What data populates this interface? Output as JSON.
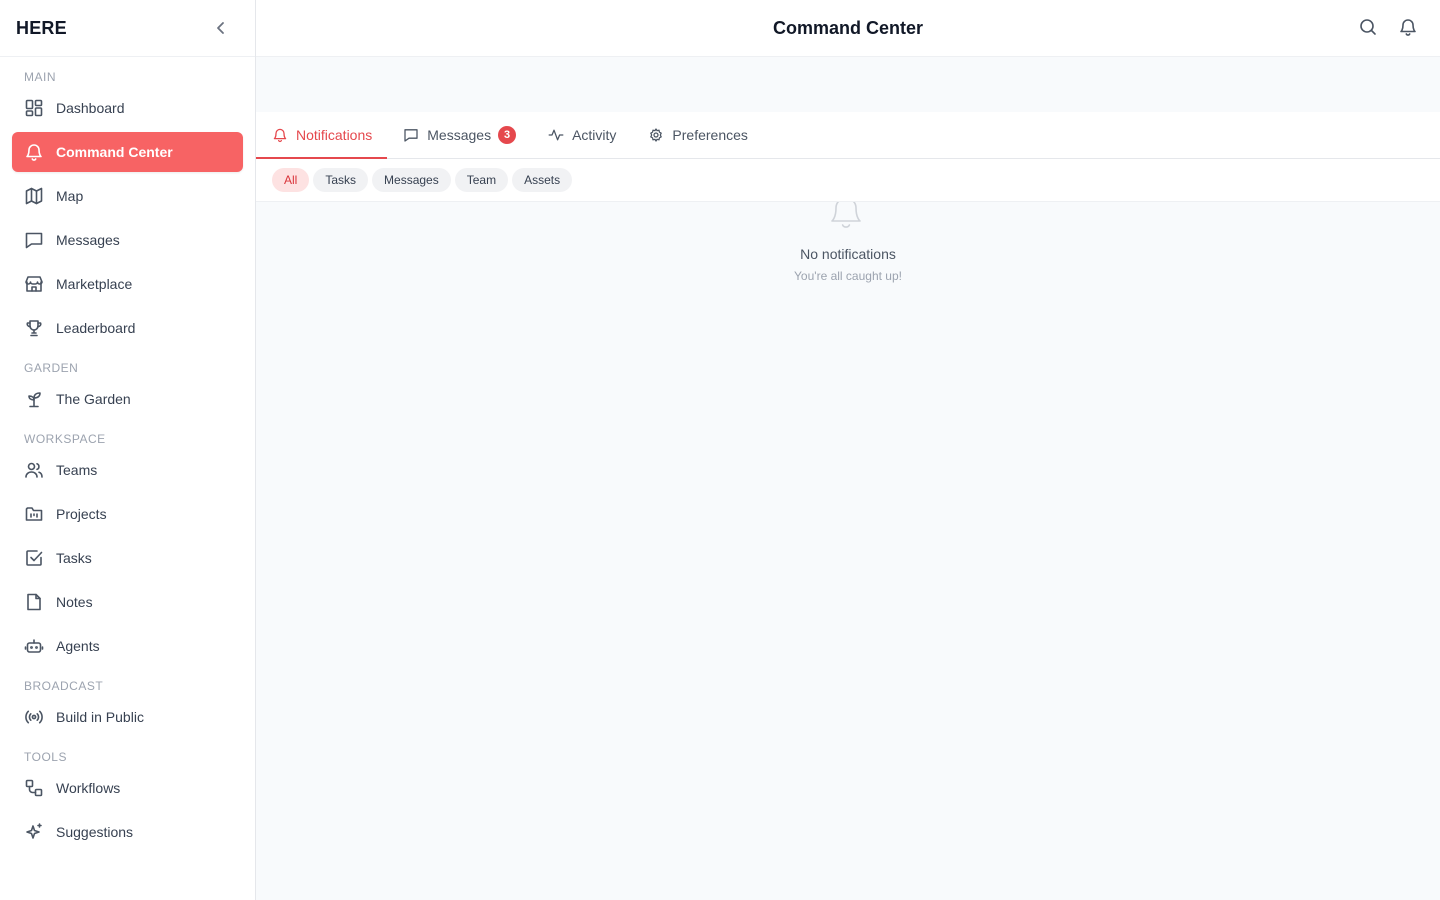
{
  "app": {
    "brand": "HERE",
    "page_title": "Command Center"
  },
  "sidebar": {
    "sections": [
      {
        "label": "MAIN",
        "items": [
          {
            "label": "Dashboard",
            "icon": "dashboard-icon"
          },
          {
            "label": "Command Center",
            "icon": "bell-icon",
            "active": true
          },
          {
            "label": "Map",
            "icon": "map-icon"
          },
          {
            "label": "Messages",
            "icon": "message-icon"
          },
          {
            "label": "Marketplace",
            "icon": "store-icon"
          },
          {
            "label": "Leaderboard",
            "icon": "trophy-icon"
          }
        ]
      },
      {
        "label": "GARDEN",
        "items": [
          {
            "label": "The Garden",
            "icon": "sprout-icon"
          }
        ]
      },
      {
        "label": "WORKSPACE",
        "items": [
          {
            "label": "Teams",
            "icon": "users-icon"
          },
          {
            "label": "Projects",
            "icon": "folder-icon"
          },
          {
            "label": "Tasks",
            "icon": "checkbox-icon"
          },
          {
            "label": "Notes",
            "icon": "note-icon"
          },
          {
            "label": "Agents",
            "icon": "bot-icon"
          }
        ]
      },
      {
        "label": "BROADCAST",
        "items": [
          {
            "label": "Build in Public",
            "icon": "broadcast-icon"
          }
        ]
      },
      {
        "label": "TOOLS",
        "items": [
          {
            "label": "Workflows",
            "icon": "workflow-icon"
          },
          {
            "label": "Suggestions",
            "icon": "sparkles-icon"
          }
        ]
      }
    ]
  },
  "tabs": [
    {
      "label": "Notifications",
      "icon": "bell-icon",
      "active": true
    },
    {
      "label": "Messages",
      "icon": "message-icon",
      "badge": "3"
    },
    {
      "label": "Activity",
      "icon": "activity-icon"
    },
    {
      "label": "Preferences",
      "icon": "gear-icon"
    }
  ],
  "filters": [
    "All",
    "Tasks",
    "Messages",
    "Team",
    "Assets"
  ],
  "empty_state": {
    "title": "No notifications",
    "subtitle": "You're all caught up!"
  },
  "colors": {
    "accent": "#f76364",
    "tab_accent": "#e5484d",
    "badge": "#e5484d"
  }
}
